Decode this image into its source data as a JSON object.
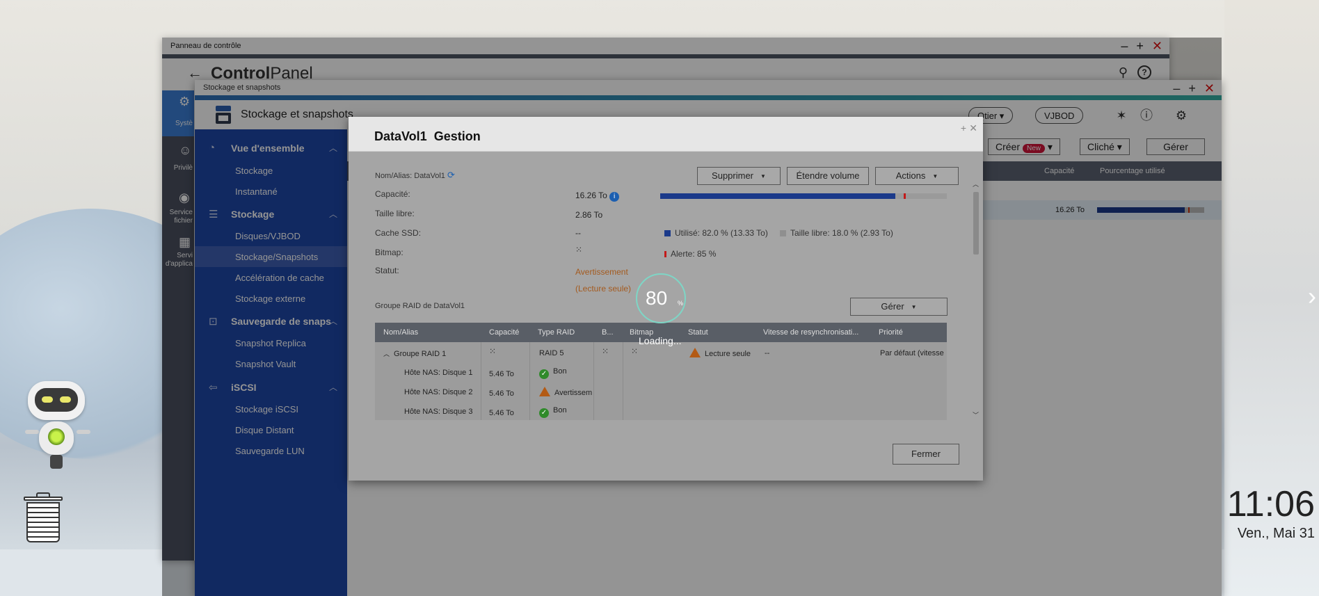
{
  "desktop": {
    "clock": {
      "time": "11:06",
      "date": "Ven., Mai 31"
    }
  },
  "control_panel": {
    "window_title": "Panneau de contrôle",
    "logo_bold": "Control",
    "logo_rest": "Panel",
    "sidebar": [
      {
        "label": "Systè"
      },
      {
        "label": "Privilè"
      },
      {
        "label": "Service fichier"
      },
      {
        "label": "Servi d'applica"
      }
    ]
  },
  "storage": {
    "window_title": "Stockage et snapshots",
    "app_title": "Stockage et snapshots",
    "header_buttons": {
      "qtier": "Qtier",
      "vjbod": "VJBOD"
    },
    "toolbar": {
      "create": "Créer",
      "new_badge": "New",
      "snapshot": "Cliché",
      "manage": "Gérer"
    },
    "table_headers": {
      "capacity": "Capacité",
      "percent_used": "Pourcentage utilisé"
    },
    "row": {
      "capacity": "16.26 To",
      "percent_used_fraction": 0.82,
      "alert_fraction": 0.85
    },
    "nav": {
      "sections": [
        {
          "label": "Vue d'ensemble",
          "items": [
            "Stockage",
            "Instantané"
          ]
        },
        {
          "label": "Stockage",
          "items": [
            "Disques/VJBOD",
            "Stockage/Snapshots",
            "Accélération de cache",
            "Stockage externe"
          ]
        },
        {
          "label": "Sauvegarde de snaps",
          "items": [
            "Snapshot Replica",
            "Snapshot Vault"
          ]
        },
        {
          "label": "iSCSI",
          "items": [
            "Stockage iSCSI",
            "Disque Distant",
            "Sauvegarde LUN"
          ]
        }
      ],
      "active_item": "Stockage/Snapshots"
    }
  },
  "dialog": {
    "title_volume": "DataVol1",
    "title_action": "Gestion",
    "alias_label": "Nom/Alias:",
    "alias_value": "DataVol1",
    "buttons": {
      "delete": "Supprimer",
      "extend": "Étendre volume",
      "actions": "Actions",
      "manage": "Gérer",
      "close": "Fermer"
    },
    "fields": {
      "capacity_label": "Capacité:",
      "capacity_value": "16.26 To",
      "free_label": "Taille libre:",
      "free_value": "2.86 To",
      "ssd_label": "Cache SSD:",
      "ssd_value": "--",
      "bitmap_label": "Bitmap:",
      "status_label": "Statut:",
      "status_value_1": "Avertissement",
      "status_value_2": "(Lecture seule)"
    },
    "usage": {
      "used_fraction": 0.82,
      "alert_fraction": 0.85,
      "used_legend": "Utilisé: 82.0 % (13.33 To)",
      "free_legend": "Taille libre: 18.0 % (2.93 To)",
      "alert_legend": "Alerte: 85 %",
      "used_color": "#1b3a8a",
      "free_color": "#8f8f8f",
      "alert_color": "#c31a1a"
    },
    "raid_group_label": "Groupe RAID de DataVol1",
    "raid_table": {
      "headers": [
        "Nom/Alias",
        "Capacité",
        "Type RAID",
        "B...",
        "Bitmap",
        "Statut",
        "Vitesse de resynchronisati...",
        "Priorité"
      ],
      "group": {
        "name": "Groupe RAID 1",
        "raid_type": "RAID 5",
        "status": "Lecture seule",
        "resync": "--",
        "priority": "Par défaut (vitesse"
      },
      "disks": [
        {
          "name": "Hôte NAS: Disque 1",
          "capacity": "5.46 To",
          "status": "Bon"
        },
        {
          "name": "Hôte NAS: Disque 2",
          "capacity": "5.46 To",
          "status": "Avertissem"
        },
        {
          "name": "Hôte NAS: Disque 3",
          "capacity": "5.46 To",
          "status": "Bon"
        }
      ]
    },
    "loading": {
      "percent": "80",
      "percent_sign": "%",
      "text": "Loading..."
    }
  }
}
